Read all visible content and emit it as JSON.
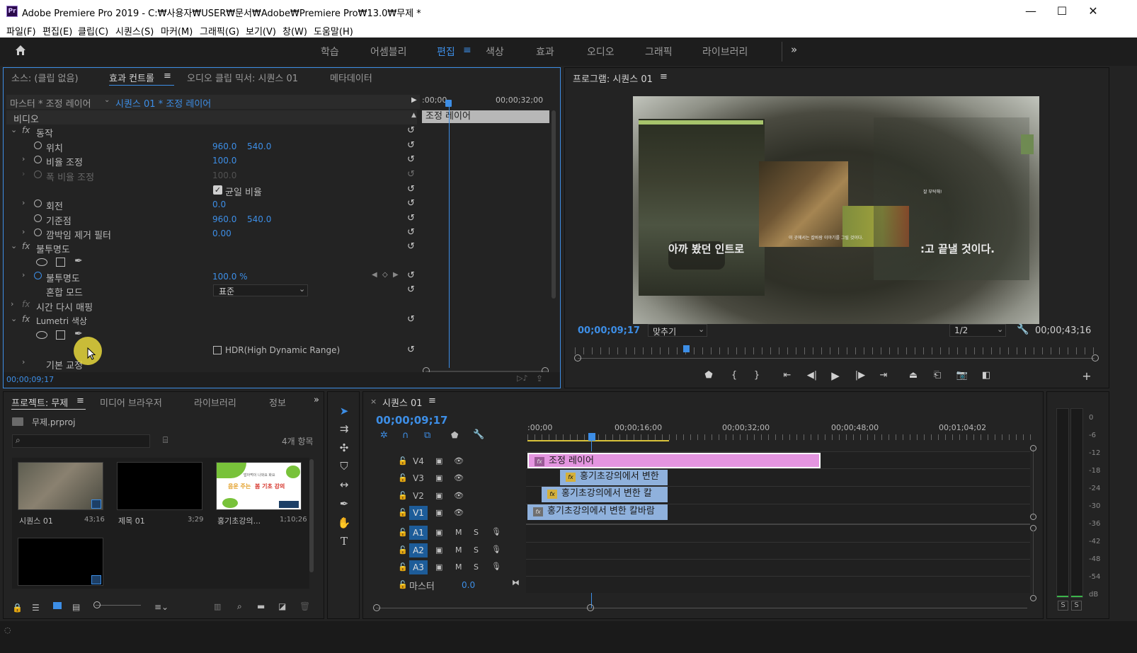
{
  "window": {
    "title": "Adobe Premiere Pro 2019 - C:₩사용자₩USER₩문서₩Adobe₩Premiere Pro₩13.0₩무제 *",
    "logo": "Pr",
    "minimize": "—",
    "maximize": "☐",
    "close": "✕"
  },
  "menu": [
    "파일(F)",
    "편집(E)",
    "클립(C)",
    "시퀀스(S)",
    "마커(M)",
    "그래픽(G)",
    "보기(V)",
    "창(W)",
    "도움말(H)"
  ],
  "workspaces": {
    "items": [
      "학습",
      "어셈블리",
      "편집",
      "색상",
      "효과",
      "오디오",
      "그래픽",
      "라이브러리"
    ],
    "active": "편집",
    "more": "»"
  },
  "effects_panel": {
    "tabs": [
      "소스: (클립 없음)",
      "효과 컨트롤",
      "오디오 클립 믹서: 시퀀스 01",
      "메타데이터"
    ],
    "master_label": "마스터 * 조정 레이어",
    "seq_label": "시퀀스 01 * 조정 레이어",
    "time_start": ":00;00",
    "time_mid": "00;00;32;00",
    "clip_name": "조정 레이어",
    "section_video": "비디오",
    "motion": "동작",
    "position": "위치",
    "position_x": "960.0",
    "position_y": "540.0",
    "scale": "비율 조정",
    "scale_val": "100.0",
    "scale_width": "폭 비율 조정",
    "scale_width_val": "100.0",
    "uniform_scale": "균일 비율",
    "rotation": "회전",
    "rotation_val": "0.0",
    "anchor": "기준점",
    "anchor_x": "960.0",
    "anchor_y": "540.0",
    "antiflicker": "깜박임 제거 필터",
    "antiflicker_val": "0.00",
    "opacity_group": "불투명도",
    "opacity": "불투명도",
    "opacity_val": "100.0 %",
    "blend_mode": "혼합 모드",
    "blend_mode_val": "표준",
    "time_remap": "시간 다시 매핑",
    "lumetri": "Lumetri 색상",
    "hdr": "HDR(High Dynamic Range)",
    "basic_correction": "기본 교정",
    "timecode": "00;00;09;17"
  },
  "program_monitor": {
    "title": "프로그램: 시퀀스 01",
    "caption_left": "아까 봤던 인트로",
    "caption_right": ":고 끝낼 것이다.",
    "small_text_1": "잘 부탁해!",
    "small_text_2": "이 곳에서는 칼바람 이야기를 그릴 것이다.",
    "timecode": "00;00;09;17",
    "fit": "맞추기",
    "resolution": "1/2",
    "duration": "00;00;43;16"
  },
  "project_panel": {
    "tabs": [
      "프로젝트: 무제",
      "미디어 브라우저",
      "라이브러리",
      "정보"
    ],
    "file": "무제.prproj",
    "count": "4개 항목",
    "items": [
      {
        "name": "시퀀스 01",
        "dur": "43;16"
      },
      {
        "name": "제목 01",
        "dur": "3;29"
      },
      {
        "name": "홍기초강의...",
        "dur": "1;10;26"
      }
    ],
    "thumb3_text_1": "밥아먹이 나와요 화요",
    "thumb3_text_2": "음운 주는",
    "thumb3_text_3": "봄 기초 강의"
  },
  "timeline": {
    "title": "시퀀스 01",
    "timecode": "00;00;09;17",
    "ruler": [
      ":00;00",
      "00;00;16;00",
      "00;00;32;00",
      "00;00;48;00",
      "00;01;04;02"
    ],
    "tracks_video": [
      "V4",
      "V3",
      "V2",
      "V1"
    ],
    "tracks_audio": [
      "A1",
      "A2",
      "A3"
    ],
    "master": "마스터",
    "master_val": "0.0",
    "clips": [
      {
        "name": "조정 레이어",
        "track": "V4"
      },
      {
        "name": "홍기초강의에서 변한",
        "track": "V3"
      },
      {
        "name": "홍기초강의에서 변한 칼",
        "track": "V2"
      },
      {
        "name": "홍기초강의에서 변한 칼바람",
        "track": "V1"
      }
    ]
  },
  "meters": {
    "labels": [
      "0",
      "-6",
      "-12",
      "-18",
      "-24",
      "-30",
      "-36",
      "-42",
      "-48",
      "-54",
      "dB"
    ],
    "solo": "S"
  },
  "colors": {
    "accent": "#3d8ee6",
    "adjustment_clip": "#e495e0",
    "video_clip": "#8fb1dc",
    "fx_badge": "#d4b03c"
  }
}
